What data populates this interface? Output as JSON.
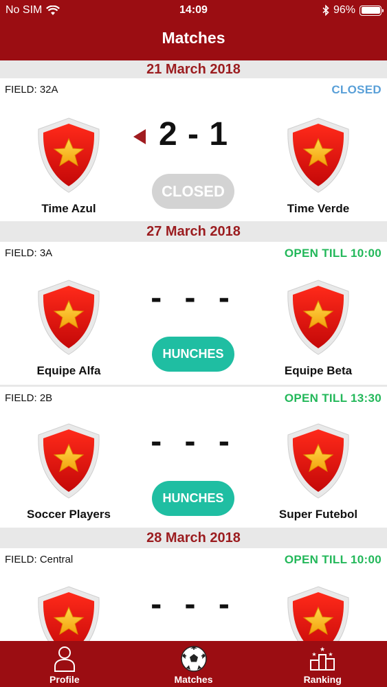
{
  "status_bar": {
    "carrier": "No SIM",
    "time": "14:09",
    "battery": "96%"
  },
  "nav": {
    "title": "Matches"
  },
  "sections": [
    {
      "date": "21 March 2018",
      "matches": [
        {
          "field": "FIELD: 32A",
          "status": "CLOSED",
          "status_type": "closed",
          "home": "Time Azul",
          "away": "Time Verde",
          "score": "2 - 1",
          "action": "CLOSED"
        }
      ]
    },
    {
      "date": "27 March 2018",
      "matches": [
        {
          "field": "FIELD: 3A",
          "status": "OPEN TILL 10:00",
          "status_type": "open",
          "home": "Equipe Alfa",
          "away": "Equipe Beta",
          "score": "- - -",
          "action": "HUNCHES"
        },
        {
          "field": "FIELD: 2B",
          "status": "OPEN TILL 13:30",
          "status_type": "open",
          "home": "Soccer Players",
          "away": "Super Futebol",
          "score": "- - -",
          "action": "HUNCHES"
        }
      ]
    },
    {
      "date": "28 March 2018",
      "matches": [
        {
          "field": "FIELD: Central",
          "status": "OPEN TILL 10:00",
          "status_type": "open",
          "home": "",
          "away": "",
          "score": "- - -",
          "action": ""
        }
      ]
    }
  ],
  "tabs": [
    {
      "label": "Profile",
      "icon": "person-icon"
    },
    {
      "label": "Matches",
      "icon": "soccer-ball-icon"
    },
    {
      "label": "Ranking",
      "icon": "podium-icon"
    }
  ],
  "colors": {
    "brand": "#9b0d12",
    "date_text": "#9b1c1f",
    "open": "#23b85a",
    "closed": "#5aa0d8",
    "hunch_button": "#1fbea2",
    "closed_button": "#d3d3d3"
  }
}
